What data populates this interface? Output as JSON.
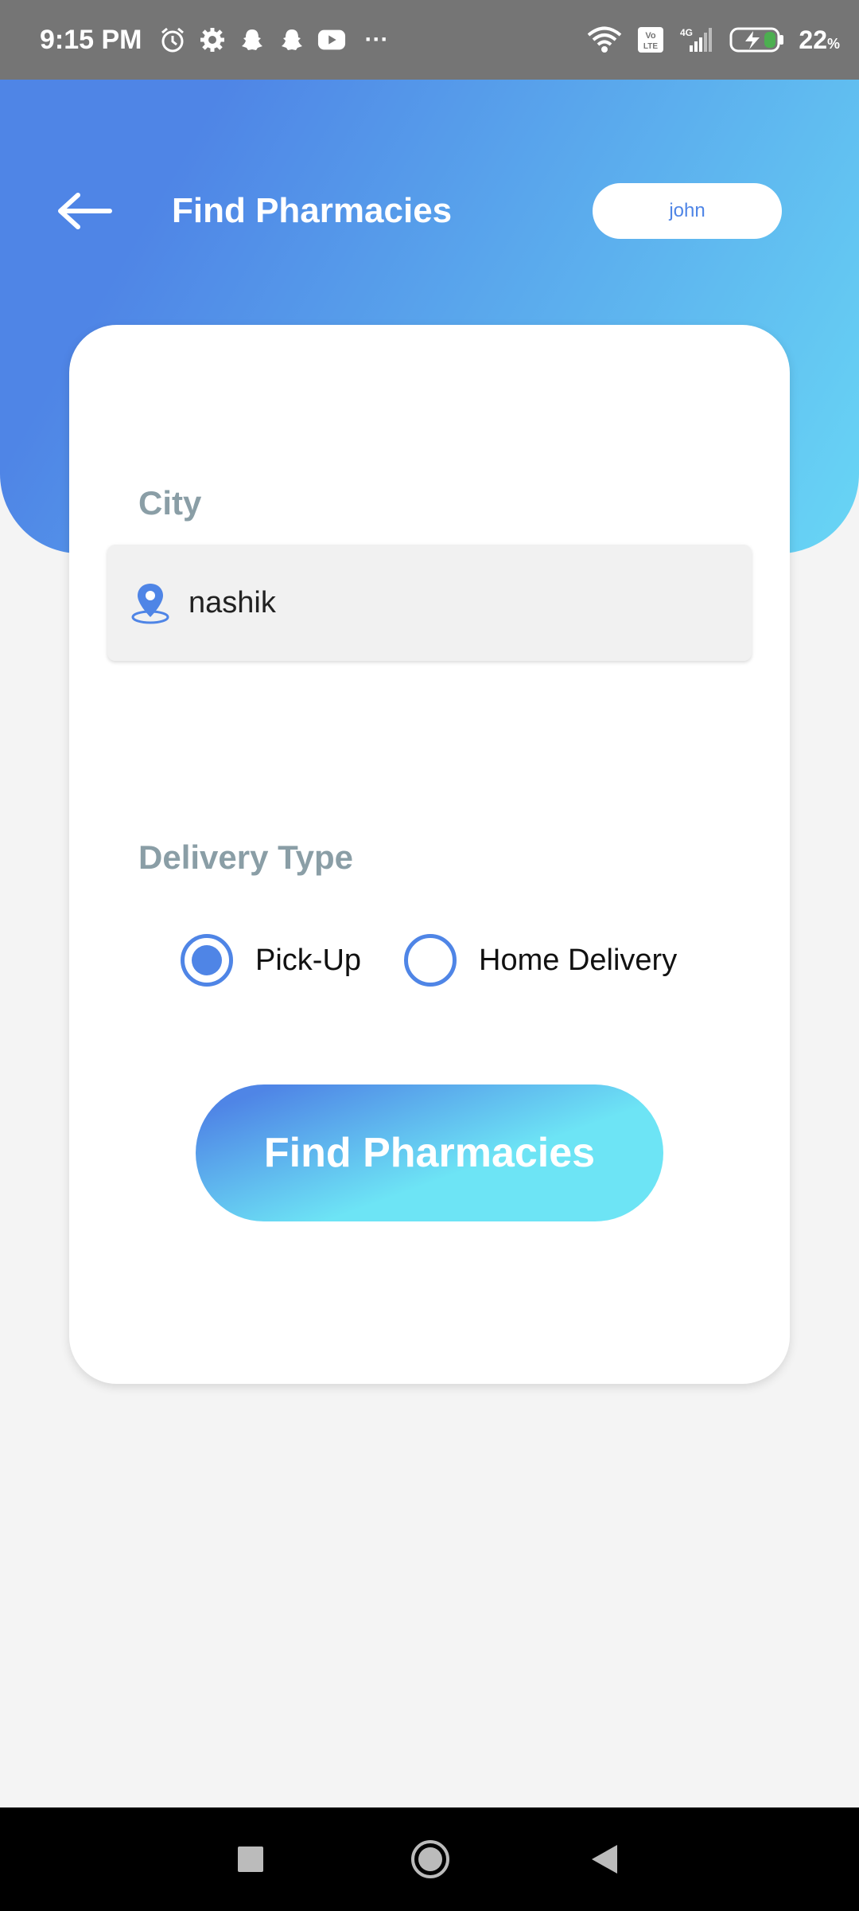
{
  "status_bar": {
    "time": "9:15 PM",
    "more": "···",
    "battery": "22",
    "battery_unit": "%",
    "icons_left": [
      "alarm-icon",
      "settings-icon",
      "snapchat-icon",
      "snapchat-icon",
      "youtube-icon"
    ],
    "icons_right": [
      "wifi-icon",
      "volte-icon",
      "signal-icon",
      "battery-charging-icon"
    ]
  },
  "header": {
    "title": "Find Pharmacies",
    "user": "john"
  },
  "form": {
    "city_label": "City",
    "city_value": "nashik",
    "delivery_label": "Delivery Type",
    "options": [
      {
        "label": "Pick-Up",
        "selected": true
      },
      {
        "label": "Home Delivery",
        "selected": false
      }
    ],
    "submit_label": "Find Pharmacies"
  },
  "colors": {
    "accent": "#4f85e6",
    "accent_light": "#68d6f5",
    "label_gray": "#8a9ea6"
  }
}
